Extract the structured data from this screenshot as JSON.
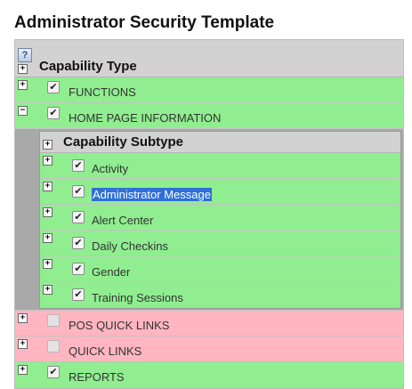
{
  "title": "Administrator Security Template",
  "header": {
    "help_glyph": "?",
    "expand_glyph": "+",
    "label": "Capability Type"
  },
  "rows": [
    {
      "toggle": "+",
      "checked": "✔",
      "label": "FUNCTIONS",
      "status": "enabled"
    },
    {
      "toggle": "−",
      "checked": "✔",
      "label": "HOME PAGE INFORMATION",
      "status": "enabled"
    }
  ],
  "subtable": {
    "header": {
      "expand_glyph": "+",
      "label": "Capability Subtype"
    },
    "rows": [
      {
        "toggle": "+",
        "checked": "✔",
        "label": "Activity"
      },
      {
        "toggle": "+",
        "checked": "✔",
        "label": "Administrator Message",
        "selected": true
      },
      {
        "toggle": "+",
        "checked": "✔",
        "label": "Alert Center"
      },
      {
        "toggle": "+",
        "checked": "✔",
        "label": "Daily Checkins"
      },
      {
        "toggle": "+",
        "checked": "✔",
        "label": "Gender"
      },
      {
        "toggle": "+",
        "checked": "✔",
        "label": "Training Sessions"
      }
    ]
  },
  "rows_after": [
    {
      "toggle": "+",
      "checked": "",
      "label": "POS QUICK LINKS",
      "status": "disabled"
    },
    {
      "toggle": "+",
      "checked": "",
      "label": "QUICK LINKS",
      "status": "disabled"
    },
    {
      "toggle": "+",
      "checked": "✔",
      "label": "REPORTS",
      "status": "enabled"
    }
  ],
  "colors": {
    "enabled_row": "#90ee90",
    "disabled_row": "#ffb6c1",
    "header_bg": "#d2d2d2",
    "selection": "#2f6fd6"
  }
}
